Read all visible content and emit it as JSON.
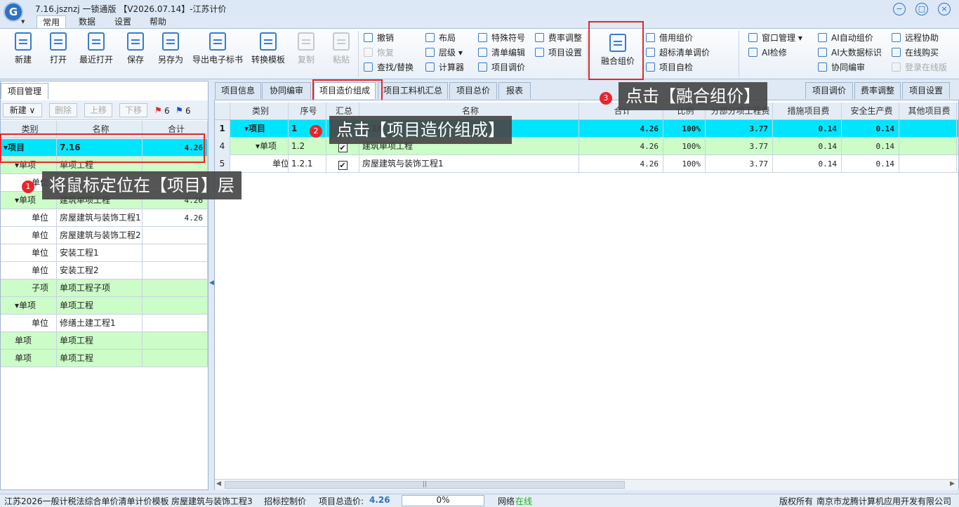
{
  "app": {
    "title": "7.16.jsznzj 一锁通版 【V2026.07.14】-江苏计价",
    "logo": "G"
  },
  "menu": {
    "tabs": [
      "常用",
      "数据",
      "设置",
      "帮助"
    ]
  },
  "ribbon": {
    "big": [
      "新建",
      "打开",
      "最近打开",
      "保存",
      "另存为",
      "导出电子标书",
      "转换模板",
      "复制",
      "粘贴"
    ],
    "g1": [
      "撤销",
      "恢复",
      "查找/替换"
    ],
    "g2": [
      "布局",
      "层级",
      "计算器"
    ],
    "g3": [
      "特殊符号",
      "清单编辑",
      "项目调价"
    ],
    "g4": [
      "费率调整",
      "项目设置"
    ],
    "fuse": "融合组价",
    "g5": [
      "借用组价",
      "超标清单调价",
      "项目自检"
    ],
    "g6": [
      "窗口管理",
      "AI检修"
    ],
    "g7": [
      "AI自动组价",
      "AI大数据标识",
      "协同编审"
    ],
    "g8": [
      "远程协助",
      "在线购买",
      "登录在线版"
    ]
  },
  "left": {
    "tab": "项目管理",
    "toolbar": {
      "new": "新建",
      "delete": "删除",
      "up": "上移",
      "down": "下移",
      "red_count": "6",
      "blue_count": "6"
    },
    "headers": [
      "类别",
      "名称",
      "合计"
    ],
    "rows": [
      {
        "type": "▾项目",
        "name": "7.16",
        "total": "4.26"
      },
      {
        "type": "▾单项",
        "name": "单项工程",
        "total": ""
      },
      {
        "type": "单位",
        "name": "",
        "total": ""
      },
      {
        "type": "▾单项",
        "name": "建筑单项工程",
        "total": "4.26"
      },
      {
        "type": "单位",
        "name": "房屋建筑与装饰工程1",
        "total": "4.26"
      },
      {
        "type": "单位",
        "name": "房屋建筑与装饰工程2",
        "total": ""
      },
      {
        "type": "单位",
        "name": "安装工程1",
        "total": ""
      },
      {
        "type": "单位",
        "name": "安装工程2",
        "total": ""
      },
      {
        "type": "子项",
        "name": "单项工程子项",
        "total": ""
      },
      {
        "type": "▾单项",
        "name": "单项工程",
        "total": ""
      },
      {
        "type": "单位",
        "name": "修缮土建工程1",
        "total": ""
      },
      {
        "type": "单项",
        "name": "单项工程",
        "total": ""
      },
      {
        "type": "单项",
        "name": "单项工程",
        "total": ""
      }
    ]
  },
  "right": {
    "tabs": [
      "项目信息",
      "协同编审",
      "项目造价组成",
      "项目工料机汇总",
      "项目总价",
      "报表"
    ],
    "right_tabs": [
      "项目调价",
      "费率调整",
      "项目设置"
    ],
    "headers": [
      "类别",
      "序号",
      "汇总",
      "名称",
      "合计",
      "比例",
      "分部分项工程费",
      "措施项目费",
      "安全生产费",
      "其他项目费"
    ],
    "rows": [
      {
        "n": "1",
        "type": "▾项目",
        "seq": "1",
        "check": "✔",
        "name": "7.16",
        "total": "4.26",
        "ratio": "100%",
        "fb": "3.77",
        "cs": "0.14",
        "aq": "0.14",
        "qt": ""
      },
      {
        "n": "4",
        "type": "▾单项",
        "seq": "1.2",
        "check": "✔",
        "name": "建筑单项工程",
        "total": "4.26",
        "ratio": "100%",
        "fb": "3.77",
        "cs": "0.14",
        "aq": "0.14",
        "qt": ""
      },
      {
        "n": "5",
        "type": "单位",
        "seq": "1.2.1",
        "check": "✔",
        "name": "房屋建筑与装饰工程1",
        "total": "4.26",
        "ratio": "100%",
        "fb": "3.77",
        "cs": "0.14",
        "aq": "0.14",
        "qt": ""
      }
    ]
  },
  "callouts": {
    "c1": "将鼠标定位在【项目】层",
    "c2": "点击【项目造价组成】",
    "c3": "点击【融合组价】",
    "b1": "1",
    "b2": "2",
    "b3": "3"
  },
  "status": {
    "template": "江苏2026一般计税法综合单价清单计价模板",
    "unit": "房屋建筑与装饰工程3",
    "control": "招标控制价",
    "total_label": "项目总造价:",
    "total_value": "4.26",
    "progress": "0%",
    "progress_value": 0,
    "net_label": "网络",
    "net_state": "在线",
    "copyright": "版权所有",
    "company": "南京市龙腾计算机应用开发有限公司"
  },
  "colors": {
    "selected": "#00e5ff",
    "green": "#ccfcc8",
    "accent": "#2f72c4",
    "highlight": "#e8262a"
  }
}
